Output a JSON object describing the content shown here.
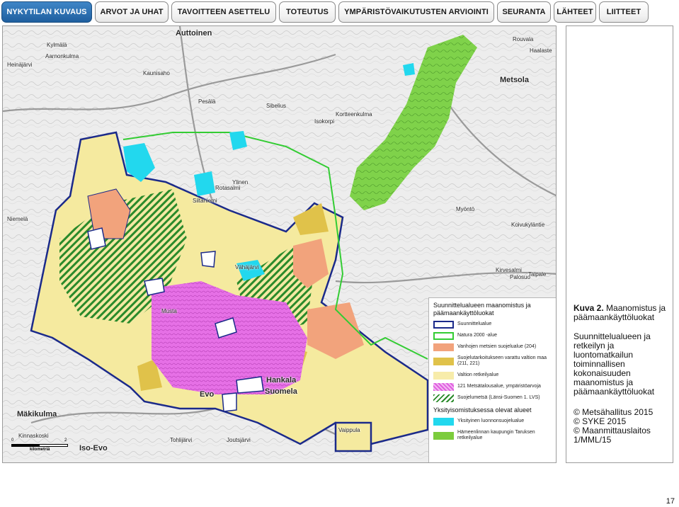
{
  "nav": {
    "tabs": [
      {
        "label": "NYKYTILAN KUVAUS",
        "active": true
      },
      {
        "label": "ARVOT JA UHAT",
        "active": false
      },
      {
        "label": "TAVOITTEEN ASETTELU",
        "active": false
      },
      {
        "label": "TOTEUTUS",
        "active": false
      },
      {
        "label": "YMPÄRISTÖVAIKUTUSTEN ARVIOINTI",
        "active": false
      },
      {
        "label": "SEURANTA",
        "active": false
      },
      {
        "label": "LÄHTEET",
        "active": false
      },
      {
        "label": "LIITTEET",
        "active": false
      }
    ],
    "active_color": "#2a6fb2"
  },
  "map": {
    "places": [
      "Auttoinen",
      "Aarnonkulma",
      "Heinäjärvi",
      "Kylmälä",
      "Kaunisaho",
      "Sibelius",
      "Pesälä",
      "Isokorpi",
      "Niemelä",
      "Siltaniemi",
      "Rotasalmi",
      "Ylinen",
      "Musta",
      "Vähäjärvi",
      "Hankala",
      "Suomela",
      "Evo",
      "Mäkikulma",
      "Kinnaskoski",
      "Iso-Evo",
      "Tohlijärvi",
      "Joutsjärvi",
      "Kirvesalmi",
      "Palosuo",
      "Taipale",
      "Vaippula",
      "Metsola",
      "Rouvala",
      "Haalaste",
      "Koivukyläntie",
      "Myöntö",
      "Kortteenkulma"
    ],
    "legend": {
      "heading1": "Suunnittelualueen maanomistus ja päämaankäyttöluokat",
      "items1": [
        {
          "label": "Suunnittelualue",
          "color": "#1b2a8a"
        },
        {
          "label": "Natura 2000 -alue",
          "color": "#33cc33"
        },
        {
          "label": "Vanhojen metsien suojelualue (204)",
          "color": "#f2a37c"
        },
        {
          "label": "Suojelutarkoitukseen varattu valtion maa (211, 221)",
          "color": "#e0c24a"
        },
        {
          "label": "Valtion retkeilyalue",
          "color": "#f7ecaa"
        },
        {
          "label": "121 Metsätalousalue, ympäristöarvoja",
          "color": "#e05ee0"
        },
        {
          "label": "Suojelumetsä (Länsi-Suomen 1. LVS)",
          "color": "#2a8a2a"
        }
      ],
      "heading2": "Yksityisomistuksessa olevat alueet",
      "items2": [
        {
          "label": "Yksityinen luonnonsuojelualue",
          "color": "#22d8ee"
        },
        {
          "label": "Hämeenlinnan kaupungin Taruksen retkeilyalue",
          "color": "#7ccc3c"
        }
      ]
    },
    "scale": {
      "start": "0",
      "end": "2",
      "unit": "kilometriä"
    }
  },
  "caption": {
    "label": "Kuva 2.",
    "title": "Maanomistus ja päämaankäyttöluokat",
    "body": "Suunnittelualueen ja retkeilyn ja luontomatkailun toiminnallisen kokonaisuuden maanomistus ja päämaankäyttöluokat",
    "credits": [
      "© Metsähallitus 2015",
      "© SYKE 2015",
      "© Maanmittauslaitos 1/MML/15"
    ]
  },
  "page_number": "17"
}
